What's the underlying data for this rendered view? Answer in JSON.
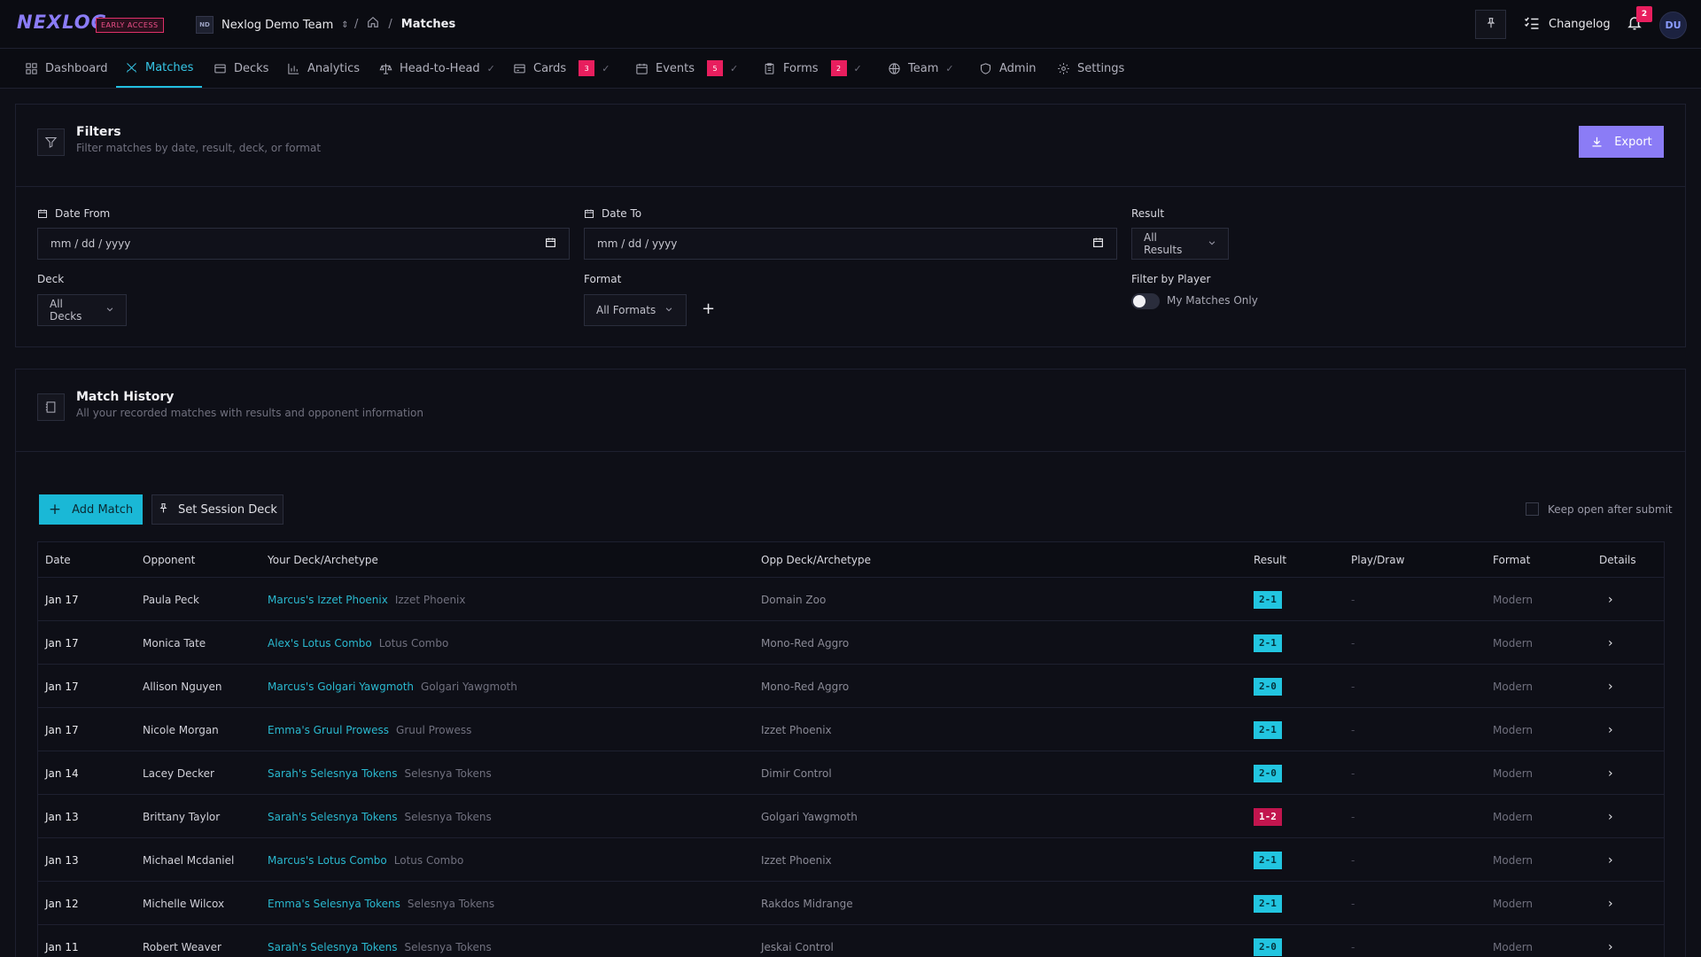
{
  "app": {
    "logo": "NEXLOG",
    "badge": "EARLY ACCESS"
  },
  "team": {
    "initials": "ND",
    "name": "Nexlog Demo Team"
  },
  "breadcrumb": {
    "separator": "/",
    "current": "Matches"
  },
  "topbar": {
    "changelog": "Changelog",
    "notifications": "2",
    "user_initials": "DU"
  },
  "nav": [
    {
      "label": "Dashboard",
      "icon": "grid-icon"
    },
    {
      "label": "Matches",
      "icon": "swords-icon",
      "active": true
    },
    {
      "label": "Decks",
      "icon": "cards-icon"
    },
    {
      "label": "Analytics",
      "icon": "chart-icon"
    },
    {
      "label": "Head-to-Head",
      "icon": "scale-icon",
      "check": "✓"
    },
    {
      "label": "Cards",
      "icon": "card-icon",
      "badge": "3",
      "check": "✓"
    },
    {
      "label": "Events",
      "icon": "calendar-icon",
      "badge": "5",
      "check": "✓"
    },
    {
      "label": "Forms",
      "icon": "clipboard-icon",
      "badge": "2",
      "check": "✓"
    },
    {
      "label": "Team",
      "icon": "globe-icon",
      "check": "✓"
    },
    {
      "label": "Admin",
      "icon": "shield-icon"
    },
    {
      "label": "Settings",
      "icon": "gear-icon"
    }
  ],
  "filters": {
    "title": "Filters",
    "subtitle": "Filter matches by date, result, deck, or format",
    "export_label": "Export",
    "date_from_label": "Date From",
    "date_from_value": "mm / dd / yyyy",
    "date_to_label": "Date To",
    "date_to_value": "mm / dd / yyyy",
    "result_label": "Result",
    "result_value": "All Results",
    "deck_label": "Deck",
    "deck_value": "All Decks",
    "format_label": "Format",
    "format_value": "All Formats",
    "add_symbol": "+",
    "player_label": "Filter by Player",
    "player_toggle_label": "My Matches Only"
  },
  "history": {
    "title": "Match History",
    "subtitle": "All your recorded matches with results and opponent information",
    "add_label": "Add Match",
    "session_label": "Set Session Deck",
    "keep_open_label": "Keep open after submit",
    "columns": [
      "Date",
      "Opponent",
      "Your Deck/Archetype",
      "Opp Deck/Archetype",
      "Result",
      "Play/Draw",
      "Format",
      "Details"
    ],
    "rows": [
      {
        "date": "Jan 17",
        "opponent": "Paula Peck",
        "deck": "Marcus's Izzet Phoenix",
        "archetype": "Izzet Phoenix",
        "opp_deck": "Domain Zoo",
        "result": "2-1",
        "outcome": "win",
        "play_draw": "-",
        "format": "Modern",
        "details": "›"
      },
      {
        "date": "Jan 17",
        "opponent": "Monica Tate",
        "deck": "Alex's Lotus Combo",
        "archetype": "Lotus Combo",
        "opp_deck": "Mono-Red Aggro",
        "result": "2-1",
        "outcome": "win",
        "play_draw": "-",
        "format": "Modern",
        "details": "›"
      },
      {
        "date": "Jan 17",
        "opponent": "Allison Nguyen",
        "deck": "Marcus's Golgari Yawgmoth",
        "archetype": "Golgari Yawgmoth",
        "opp_deck": "Mono-Red Aggro",
        "result": "2-0",
        "outcome": "win",
        "play_draw": "-",
        "format": "Modern",
        "details": "›"
      },
      {
        "date": "Jan 17",
        "opponent": "Nicole Morgan",
        "deck": "Emma's Gruul Prowess",
        "archetype": "Gruul Prowess",
        "opp_deck": "Izzet Phoenix",
        "result": "2-1",
        "outcome": "win",
        "play_draw": "-",
        "format": "Modern",
        "details": "›"
      },
      {
        "date": "Jan 14",
        "opponent": "Lacey Decker",
        "deck": "Sarah's Selesnya Tokens",
        "archetype": "Selesnya Tokens",
        "opp_deck": "Dimir Control",
        "result": "2-0",
        "outcome": "win",
        "play_draw": "-",
        "format": "Modern",
        "details": "›"
      },
      {
        "date": "Jan 13",
        "opponent": "Brittany Taylor",
        "deck": "Sarah's Selesnya Tokens",
        "archetype": "Selesnya Tokens",
        "opp_deck": "Golgari Yawgmoth",
        "result": "1-2",
        "outcome": "loss",
        "play_draw": "-",
        "format": "Modern",
        "details": "›"
      },
      {
        "date": "Jan 13",
        "opponent": "Michael Mcdaniel",
        "deck": "Marcus's Lotus Combo",
        "archetype": "Lotus Combo",
        "opp_deck": "Izzet Phoenix",
        "result": "2-1",
        "outcome": "win",
        "play_draw": "-",
        "format": "Modern",
        "details": "›"
      },
      {
        "date": "Jan 12",
        "opponent": "Michelle Wilcox",
        "deck": "Emma's Selesnya Tokens",
        "archetype": "Selesnya Tokens",
        "opp_deck": "Rakdos Midrange",
        "result": "2-1",
        "outcome": "win",
        "play_draw": "-",
        "format": "Modern",
        "details": "›"
      },
      {
        "date": "Jan 11",
        "opponent": "Robert Weaver",
        "deck": "Sarah's Selesnya Tokens",
        "archetype": "Selesnya Tokens",
        "opp_deck": "Jeskai Control",
        "result": "2-0",
        "outcome": "win",
        "play_draw": "-",
        "format": "Modern",
        "details": "›"
      }
    ]
  },
  "colors": {
    "accent": "#22bfe0",
    "brand": "#8b7cf6",
    "win": "#22c5e0",
    "loss": "#c2154e",
    "alert": "#e81e5e"
  }
}
